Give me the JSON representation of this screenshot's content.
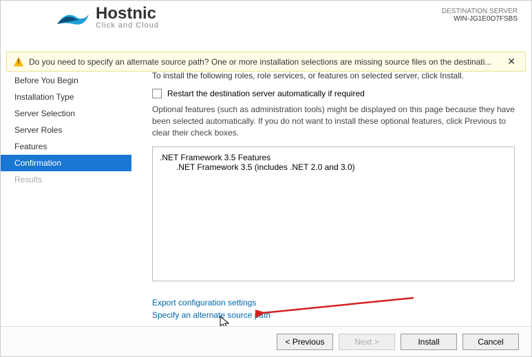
{
  "header": {
    "logo_main": "Hostnic",
    "logo_sub": "Click and Cloud",
    "dest_label": "DESTINATION SERVER",
    "dest_name": "WIN-JG1E0O7FSBS"
  },
  "warning": {
    "text": "Do you need to specify an alternate source path? One or more installation selections are missing source files on the destinati..."
  },
  "sidebar": {
    "items": [
      {
        "label": "Before You Begin"
      },
      {
        "label": "Installation Type"
      },
      {
        "label": "Server Selection"
      },
      {
        "label": "Server Roles"
      },
      {
        "label": "Features"
      },
      {
        "label": "Confirmation"
      },
      {
        "label": "Results"
      }
    ]
  },
  "main": {
    "intro": "To install the following roles, role services, or features on selected server, click Install.",
    "restart_label": "Restart the destination server automatically if required",
    "optional_text": "Optional features (such as administration tools) might be displayed on this page because they have been selected automatically. If you do not want to install these optional features, click Previous to clear their check boxes.",
    "features": {
      "parent": ".NET Framework 3.5 Features",
      "child": ".NET Framework 3.5 (includes .NET 2.0 and 3.0)"
    },
    "link_export": "Export configuration settings",
    "link_source": "Specify an alternate source path"
  },
  "footer": {
    "previous": "< Previous",
    "next": "Next >",
    "install": "Install",
    "cancel": "Cancel"
  }
}
